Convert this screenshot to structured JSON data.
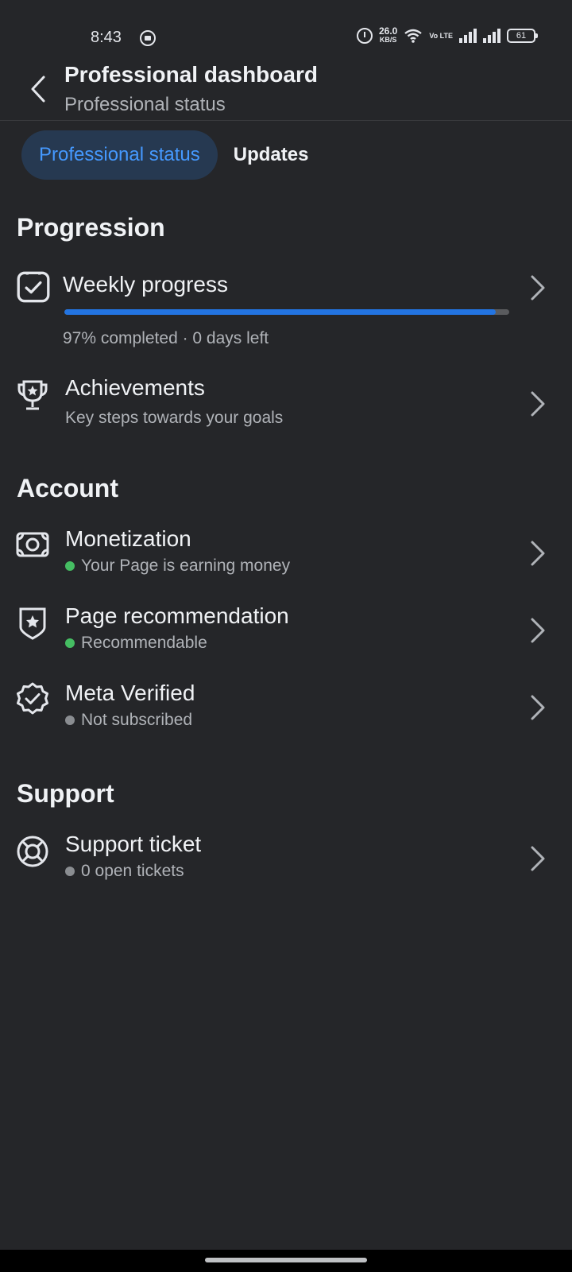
{
  "status_bar": {
    "time": "8:43",
    "net_speed": "26.0",
    "net_unit": "KB/S",
    "volte": "Vo LTE",
    "battery": "61"
  },
  "header": {
    "title": "Professional dashboard",
    "subtitle": "Professional status"
  },
  "tabs": [
    {
      "label": "Professional status",
      "active": true
    },
    {
      "label": "Updates",
      "active": false
    }
  ],
  "progression": {
    "title": "Progression",
    "weekly": {
      "title": "Weekly progress",
      "progress": 0.97,
      "status": "97% completed · 0 days left"
    },
    "achievements": {
      "title": "Achievements",
      "subtitle": "Key steps towards your goals"
    }
  },
  "account": {
    "title": "Account",
    "items": [
      {
        "title": "Monetization",
        "status": "Your Page is earning money",
        "status_color": "#45bd62",
        "icon": "money-icon"
      },
      {
        "title": "Page recommendation",
        "status": "Recommendable",
        "status_color": "#45bd62",
        "icon": "shield-star-icon"
      },
      {
        "title": "Meta Verified",
        "status": "Not subscribed",
        "status_color": "#8a8d91",
        "icon": "verified-badge-icon"
      }
    ]
  },
  "support": {
    "title": "Support",
    "ticket": {
      "title": "Support ticket",
      "status": "0 open tickets",
      "status_color": "#8a8d91"
    }
  },
  "colors": {
    "background": "#252629",
    "accent": "#2374e1",
    "active_tab_bg": "#263951",
    "active_tab_text": "#4599ff"
  }
}
